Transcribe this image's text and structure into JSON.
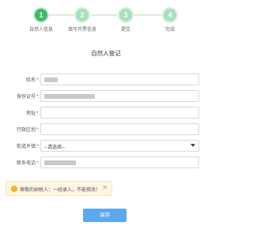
{
  "steps": [
    {
      "number": "1",
      "label": "自然人信息",
      "state": "active"
    },
    {
      "number": "2",
      "label": "填写开票信息",
      "state": "pending"
    },
    {
      "number": "3",
      "label": "提交",
      "state": "pending"
    },
    {
      "number": "4",
      "label": "完成",
      "state": "pending"
    }
  ],
  "form": {
    "title": "自然人登记",
    "fields": [
      {
        "label": "姓名",
        "required": "*",
        "value": "",
        "masked": true
      },
      {
        "label": "身份证号",
        "required": "*",
        "value": "",
        "masked": true
      },
      {
        "label": "地址",
        "required": "*",
        "value": "",
        "masked": false
      },
      {
        "label": "行政区划",
        "required": "*",
        "value": "",
        "masked": false
      },
      {
        "label": "街道乡镇",
        "required": "*",
        "value": "--请选择--",
        "masked": false
      },
      {
        "label": "联系电话",
        "required": "*",
        "value": "",
        "masked": true
      }
    ]
  },
  "notice": {
    "text": "尊敬的纳税人：一经录入，不能修改！",
    "close_symbol": "✕"
  },
  "submit_label": "保存",
  "colors": {
    "active_step": "#3fb96b",
    "pending_step": "#a9e0bd",
    "required_mark": "#e0463c",
    "button": "#5aa9ee",
    "notice_bg": "#fdf6e4",
    "warn_icon": "#f5b623"
  }
}
